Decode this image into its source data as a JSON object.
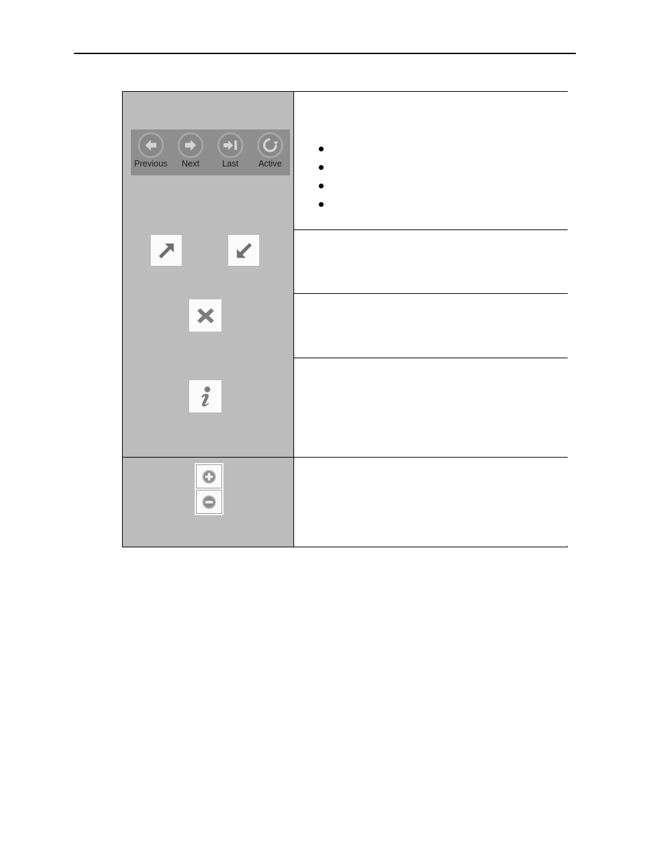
{
  "page": {
    "header_rule": "",
    "background_color": "#ffffff"
  },
  "colors": {
    "cell_gray": "#bcbcbc",
    "toolbar_gray": "#8e8e8e",
    "button_gray": "#888888",
    "button_ring": "#a6a6a6",
    "glyph_light": "#d2d2d2",
    "glyph_dark": "#7a7a7a",
    "border": "#000000",
    "tile_white": "#fbfbfb"
  },
  "icon_table": {
    "rows": [
      {
        "id": "navigation-row",
        "icon_group": "navigation-toolbar",
        "description": "",
        "bullets": [
          "",
          "",
          "",
          ""
        ]
      },
      {
        "id": "expand-restore-row",
        "icon_group": "expand-restore-tiles",
        "description": ""
      },
      {
        "id": "close-row",
        "icon_group": "close-tile",
        "description": ""
      },
      {
        "id": "info-row",
        "icon_group": "info-tile",
        "description": ""
      },
      {
        "id": "zoom-row",
        "icon_group": "zoom-stack",
        "description": ""
      }
    ]
  },
  "navigation_toolbar": {
    "buttons": [
      {
        "label": "Previous",
        "icon": "arrow-left-icon"
      },
      {
        "label": "Next",
        "icon": "arrow-right-icon"
      },
      {
        "label": "Last",
        "icon": "arrow-to-end-icon"
      },
      {
        "label": "Active",
        "icon": "refresh-circle-icon"
      }
    ]
  },
  "tiles": {
    "expand": {
      "icon": "arrow-up-right-icon"
    },
    "restore": {
      "icon": "arrow-down-left-icon"
    },
    "close": {
      "icon": "close-x-icon"
    },
    "info": {
      "icon": "info-i-icon"
    }
  },
  "zoom_controls": {
    "zoom_in": {
      "icon": "zoom-in-plus-icon"
    },
    "zoom_out": {
      "icon": "zoom-out-minus-icon"
    }
  }
}
